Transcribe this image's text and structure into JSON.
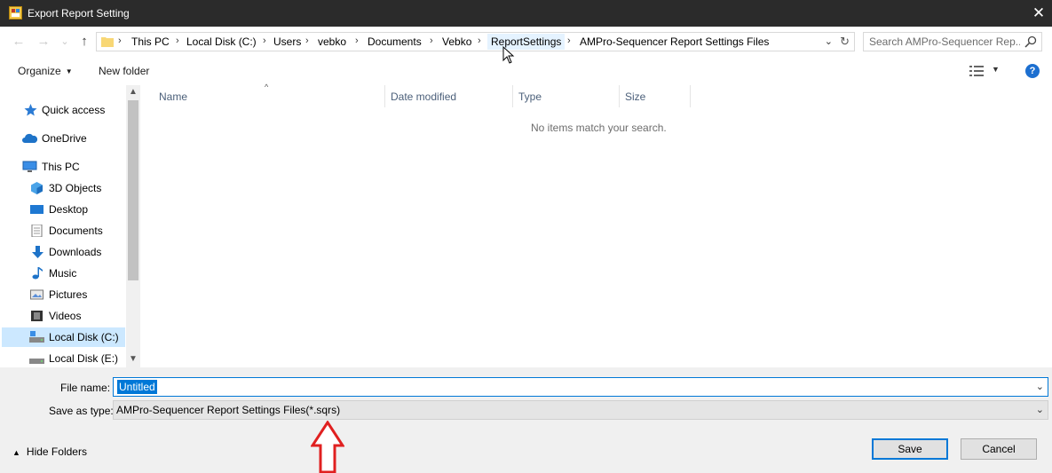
{
  "window": {
    "title": "Export Report Setting",
    "close_glyph": "✕"
  },
  "nav_buttons": {
    "back": "←",
    "forward": "→",
    "dropdown": "⌄",
    "up": "↑"
  },
  "breadcrumb": {
    "items": [
      "This PC",
      "Local Disk (C:)",
      "Users",
      "vebko",
      "Documents",
      "Vebko",
      "ReportSettings",
      "AMPro-Sequencer Report Settings Files"
    ],
    "separator": "›"
  },
  "search": {
    "placeholder": "Search AMPro-Sequencer Rep..."
  },
  "toolbar": {
    "organize_label": "Organize",
    "new_folder_label": "New folder",
    "help_glyph": "?"
  },
  "sidebar": {
    "items": [
      {
        "label": "Quick access",
        "icon": "star-icon"
      },
      {
        "label": "OneDrive",
        "icon": "cloud-icon"
      },
      {
        "label": "This PC",
        "icon": "computer-icon"
      },
      {
        "label": "3D Objects",
        "icon": "cube-icon"
      },
      {
        "label": "Desktop",
        "icon": "desktop-icon"
      },
      {
        "label": "Documents",
        "icon": "document-icon"
      },
      {
        "label": "Downloads",
        "icon": "download-icon"
      },
      {
        "label": "Music",
        "icon": "music-icon"
      },
      {
        "label": "Pictures",
        "icon": "pictures-icon"
      },
      {
        "label": "Videos",
        "icon": "video-icon"
      },
      {
        "label": "Local Disk (C:)",
        "icon": "drive-icon",
        "selected": true
      },
      {
        "label": "Local Disk (E:)",
        "icon": "drive-icon"
      }
    ]
  },
  "file_list": {
    "columns": [
      "Name",
      "Date modified",
      "Type",
      "Size"
    ],
    "empty_message": "No items match your search."
  },
  "form": {
    "file_name_label": "File name:",
    "file_name_value": "Untitled",
    "save_as_type_label": "Save as type:",
    "save_as_type_value": "AMPro-Sequencer Report Settings Files(*.sqrs)"
  },
  "footer": {
    "hide_folders_label": "Hide Folders",
    "save_label": "Save",
    "cancel_label": "Cancel"
  },
  "colors": {
    "accent": "#0078d7",
    "selection": "#cce8ff",
    "title_bar": "#2b2b2b",
    "annotation_arrow": "#e02020"
  }
}
